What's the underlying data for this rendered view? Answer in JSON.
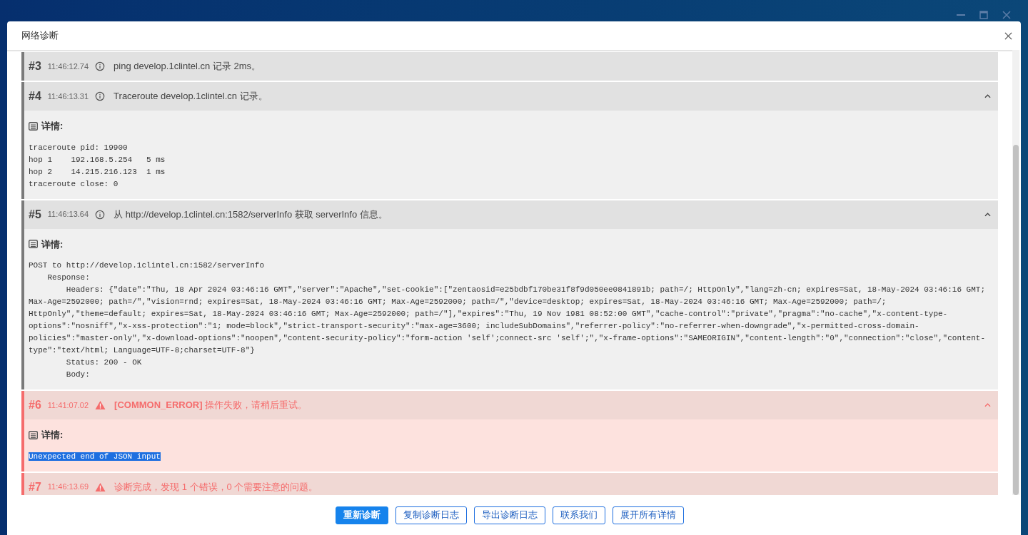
{
  "dialog": {
    "title": "网络诊断"
  },
  "entries": [
    {
      "number": "#3",
      "time": "11:46:12.74",
      "kind": "info",
      "message": "ping develop.1clintel.cn 记录 2ms。"
    },
    {
      "number": "#4",
      "time": "11:46:13.31",
      "kind": "info",
      "message": "Traceroute develop.1clintel.cn 记录。",
      "expanded": true,
      "details_label": "详情:",
      "details": "traceroute pid: 19900\nhop 1    192.168.5.254   5 ms\nhop 2    14.215.216.123  1 ms\ntraceroute close: 0",
      "details_selected": false
    },
    {
      "number": "#5",
      "time": "11:46:13.64",
      "kind": "info",
      "message": "从 http://develop.1clintel.cn:1582/serverInfo 获取 serverInfo 信息。",
      "expanded": true,
      "details_label": "详情:",
      "details": "POST to http://develop.1clintel.cn:1582/serverInfo\n    Response:\n        Headers: {\"date\":\"Thu, 18 Apr 2024 03:46:16 GMT\",\"server\":\"Apache\",\"set-cookie\":[\"zentaosid=e25bdbf170be31f8f9d050ee0841891b; path=/; HttpOnly\",\"lang=zh-cn; expires=Sat, 18-May-2024 03:46:16 GMT; Max-Age=2592000; path=/\",\"vision=rnd; expires=Sat, 18-May-2024 03:46:16 GMT; Max-Age=2592000; path=/\",\"device=desktop; expires=Sat, 18-May-2024 03:46:16 GMT; Max-Age=2592000; path=/; HttpOnly\",\"theme=default; expires=Sat, 18-May-2024 03:46:16 GMT; Max-Age=2592000; path=/\"],\"expires\":\"Thu, 19 Nov 1981 08:52:00 GMT\",\"cache-control\":\"private\",\"pragma\":\"no-cache\",\"x-content-type-options\":\"nosniff\",\"x-xss-protection\":\"1; mode=block\",\"strict-transport-security\":\"max-age=3600; includeSubDomains\",\"referrer-policy\":\"no-referrer-when-downgrade\",\"x-permitted-cross-domain-policies\":\"master-only\",\"x-download-options\":\"noopen\",\"content-security-policy\":\"form-action 'self';connect-src 'self';\",\"x-frame-options\":\"SAMEORIGIN\",\"content-length\":\"0\",\"connection\":\"close\",\"content-type\":\"text/html; Language=UTF-8;charset=UTF-8\"}\n        Status: 200 - OK\n        Body:",
      "details_selected": false
    },
    {
      "number": "#6",
      "time": "11:41:07.02",
      "kind": "error",
      "message": "**[COMMON_ERROR]** 操作失败，请稍后重试。",
      "expanded": true,
      "details_label": "详情:",
      "details": "Unexpected end of JSON input",
      "details_selected": true
    },
    {
      "number": "#7",
      "time": "11:46:13.69",
      "kind": "error",
      "message": "诊断完成，发现 1 个错误，0 个需要注意的问题。"
    }
  ],
  "buttons": [
    {
      "label": "重新诊断",
      "primary": true
    },
    {
      "label": "复制诊断日志",
      "primary": false
    },
    {
      "label": "导出诊断日志",
      "primary": false
    },
    {
      "label": "联系我们",
      "primary": false
    },
    {
      "label": "展开所有详情",
      "primary": false
    }
  ]
}
